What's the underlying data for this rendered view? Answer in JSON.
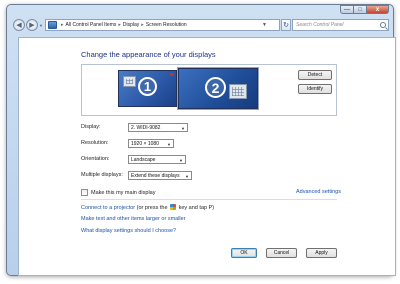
{
  "window": {
    "controls": {
      "minimize": "—",
      "maximize": "□",
      "close": "x"
    }
  },
  "toolbar": {
    "back_glyph": "◀",
    "forward_glyph": "▶",
    "breadcrumbs": [
      "All Control Panel Items",
      "Display",
      "Screen Resolution"
    ],
    "separator": "▸",
    "refresh_glyph": "↻",
    "search_placeholder": "Search Control Panel"
  },
  "main": {
    "heading": "Change the appearance of your displays",
    "monitors": [
      {
        "number": "1",
        "selected": false
      },
      {
        "number": "2",
        "selected": true
      }
    ],
    "detect_label": "Detect",
    "identify_label": "Identify",
    "display": {
      "label": "Display:",
      "value": "2. WIDI-9082"
    },
    "resolution": {
      "label": "Resolution:",
      "value": "1920 × 1080"
    },
    "orientation": {
      "label": "Orientation:",
      "value": "Landscape"
    },
    "multiple_displays": {
      "label": "Multiple displays:",
      "value": "Extend these displays"
    },
    "main_display_label": "Make this my main display",
    "advanced_link": "Advanced settings",
    "links": {
      "projector_pre": "Connect to a projector",
      "projector_post": "(or press the",
      "projector_key": "key and tap P)",
      "text_size": "Make text and other items larger or smaller",
      "which_settings": "What display settings should I choose?"
    },
    "buttons": {
      "ok": "OK",
      "cancel": "Cancel",
      "apply": "Apply"
    }
  },
  "colors": {
    "heading": "#1e3287",
    "link": "#1c53a8",
    "monitor_fill": "#2a57a6",
    "frame": "#b9d0ea"
  },
  "icons": [
    "back-arrow-icon",
    "forward-arrow-icon",
    "control-panel-icon",
    "refresh-icon",
    "search-icon",
    "windows-key-icon",
    "dropdown-arrow-icon"
  ]
}
